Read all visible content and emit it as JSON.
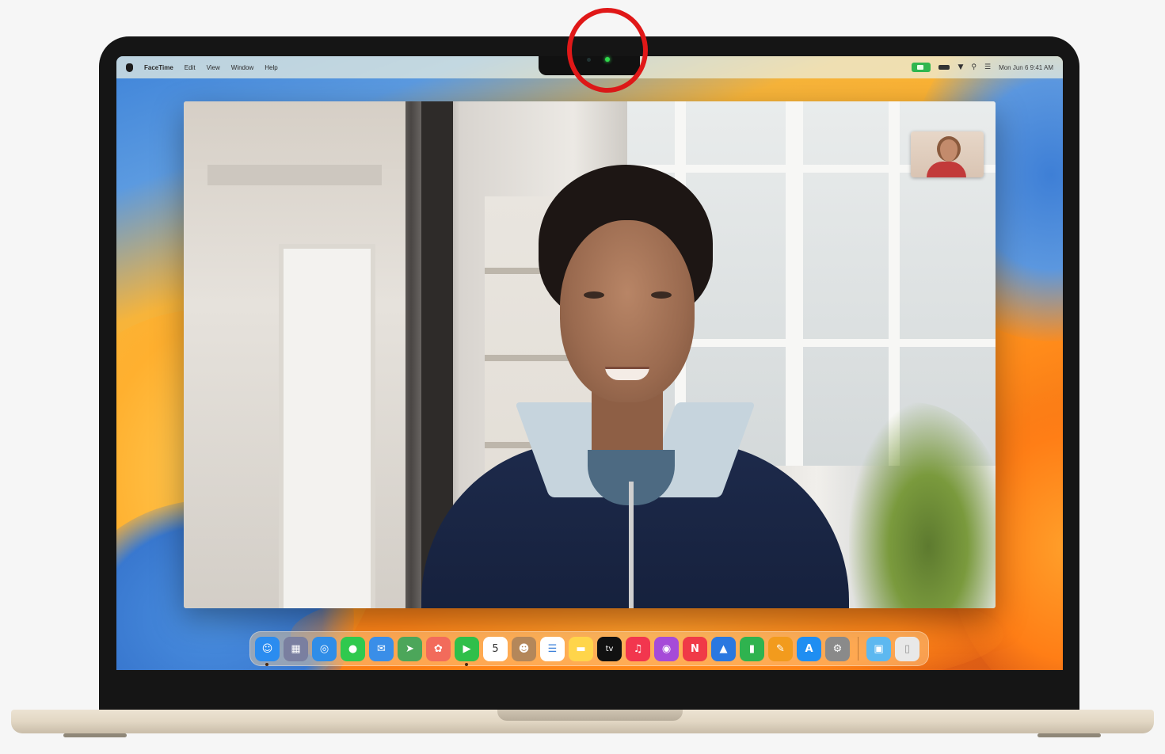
{
  "menubar": {
    "app_name": "FaceTime",
    "items": [
      "Edit",
      "View",
      "Window",
      "Help"
    ],
    "status_icons": [
      "camera-in-use-icon",
      "battery-icon",
      "wifi-icon",
      "search-icon",
      "control-center-icon"
    ],
    "clock": "Mon Jun 6  9:41 AM"
  },
  "camera": {
    "indicator_color": "#2fd94b",
    "highlight_color": "#e01818"
  },
  "facetime_window": {
    "main_video": "remote-participant-video",
    "self_view": "self-view-thumbnail"
  },
  "dock": {
    "apps": [
      {
        "name": "finder",
        "glyph": "☺",
        "color": "#2a8cf0"
      },
      {
        "name": "launchpad",
        "glyph": "▦",
        "color": "#7a7fa0"
      },
      {
        "name": "safari",
        "glyph": "◎",
        "color": "#2f8de8"
      },
      {
        "name": "messages",
        "glyph": "●",
        "color": "#2fc94e"
      },
      {
        "name": "mail",
        "glyph": "✉",
        "color": "#3a8ee8"
      },
      {
        "name": "maps",
        "glyph": "➤",
        "color": "#4ca65a"
      },
      {
        "name": "photos",
        "glyph": "✿",
        "color": "#f26b5b"
      },
      {
        "name": "facetime",
        "glyph": "▶",
        "color": "#2fbf4a"
      },
      {
        "name": "calendar",
        "glyph": "5",
        "color": "#ffffff"
      },
      {
        "name": "contacts",
        "glyph": "☻",
        "color": "#b4875a"
      },
      {
        "name": "reminders",
        "glyph": "☰",
        "color": "#ffffff"
      },
      {
        "name": "notes",
        "glyph": "▬",
        "color": "#ffd54a"
      },
      {
        "name": "apple-tv",
        "glyph": "tv",
        "color": "#111111"
      },
      {
        "name": "music",
        "glyph": "♫",
        "color": "#f2364e"
      },
      {
        "name": "podcasts",
        "glyph": "◉",
        "color": "#a64bd8"
      },
      {
        "name": "news",
        "glyph": "N",
        "color": "#f03a47"
      },
      {
        "name": "keynote",
        "glyph": "▲",
        "color": "#2a78e0"
      },
      {
        "name": "numbers",
        "glyph": "▮",
        "color": "#2fb34f"
      },
      {
        "name": "pages",
        "glyph": "✎",
        "color": "#f29b1d"
      },
      {
        "name": "app-store",
        "glyph": "A",
        "color": "#1f8ef2"
      },
      {
        "name": "system-settings",
        "glyph": "⚙",
        "color": "#8a8a8a"
      }
    ],
    "extras": [
      {
        "name": "downloads-folder",
        "glyph": "▣",
        "color": "#5db8f0"
      },
      {
        "name": "trash",
        "glyph": "▯",
        "color": "#e8e8e8"
      }
    ],
    "calendar_day": "5"
  }
}
